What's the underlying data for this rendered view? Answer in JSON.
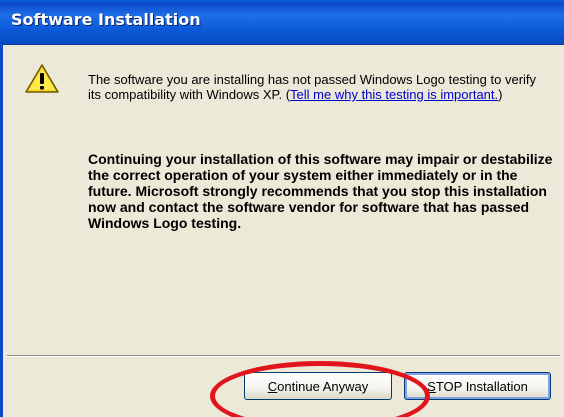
{
  "window": {
    "title": "Software Installation"
  },
  "message": {
    "line1_text": "The software you are installing has not passed Windows Logo testing to verify its compatibility with Windows XP. (",
    "link_text": "Tell me why this testing is important.",
    "line1_close": ")",
    "warning_text": "Continuing your installation of this software may impair or destabilize the correct operation of your system either immediately or in the future. Microsoft strongly recommends that you stop this installation now and contact the software vendor for software that has passed Windows Logo testing."
  },
  "buttons": {
    "continue": {
      "mnemonic": "C",
      "rest": "ontinue Anyway"
    },
    "stop": {
      "mnemonic": "S",
      "rest": "TOP Installation"
    }
  },
  "icons": {
    "warning": "warning-icon"
  },
  "colors": {
    "title_bar": "#0a58d6",
    "dialog_bg": "#ece9d8",
    "link": "#0000cc",
    "annotation_circle": "#e0161c"
  }
}
